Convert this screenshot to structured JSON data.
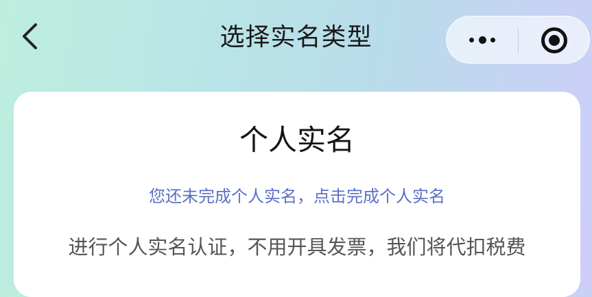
{
  "header": {
    "title": "选择实名类型",
    "back_icon": "chevron-left-icon",
    "capsule": {
      "more_icon": "more-dots-icon",
      "close_icon": "target-close-icon"
    }
  },
  "card": {
    "title": "个人实名",
    "link_text": "您还未完成个人实名，点击完成个人实名",
    "description": "进行个人实名认证，不用开具发票，我们将代扣税费",
    "link_color": "#5b6fc6"
  }
}
